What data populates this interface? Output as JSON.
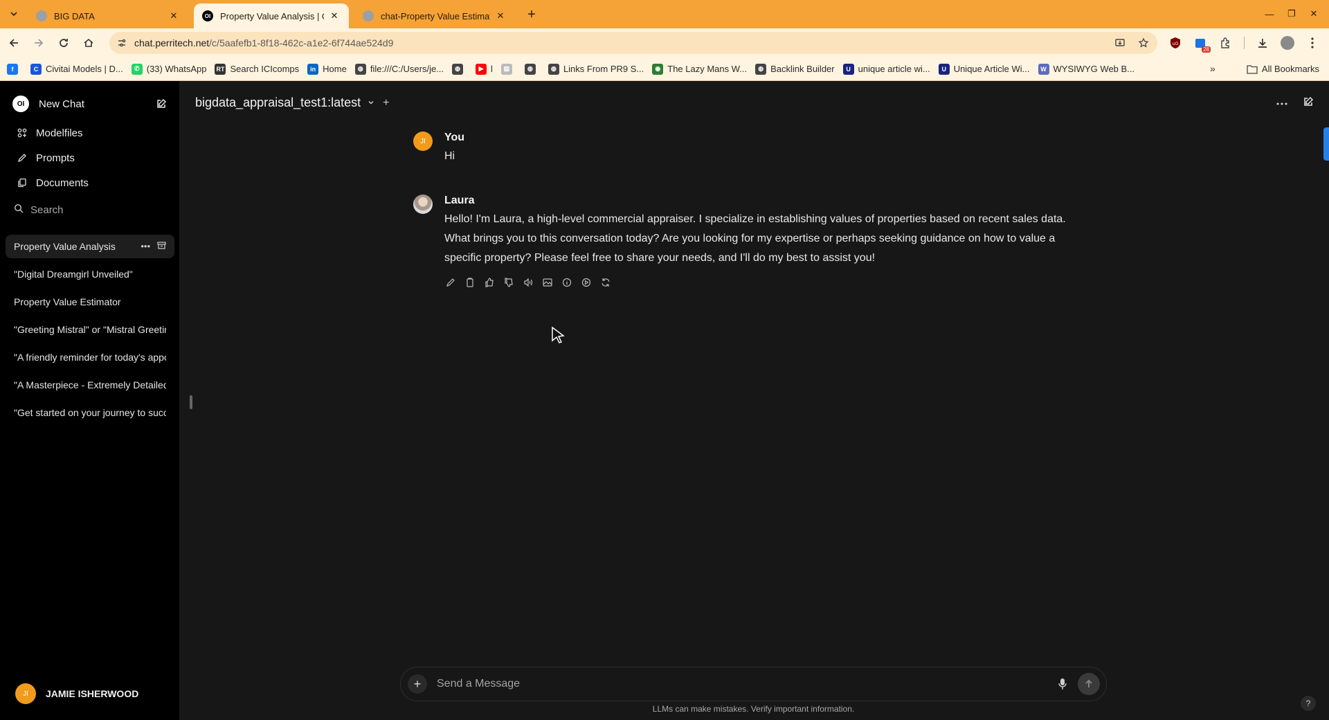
{
  "browser": {
    "tabs": [
      {
        "title": "BIG DATA",
        "active": false
      },
      {
        "title": "Property Value Analysis | Op",
        "active": true,
        "favicon_text": "OI"
      },
      {
        "title": "chat-Property Value Estimat",
        "active": false
      }
    ],
    "url_domain": "chat.perritech.net",
    "url_path": "/c/5aafefb1-8f18-462c-a1e2-6f744ae524d9",
    "extension_badge": "28",
    "bookmarks": [
      {
        "label": "",
        "icon": "facebook-icon",
        "color": "#1877f2",
        "glyph": "f"
      },
      {
        "label": "Civitai Models | D...",
        "icon": "civitai-icon",
        "color": "#1a56db",
        "glyph": "C"
      },
      {
        "label": "(33) WhatsApp",
        "icon": "whatsapp-icon",
        "color": "#25d366",
        "glyph": "✆"
      },
      {
        "label": "Search ICIcomps",
        "icon": "rt-icon",
        "color": "#333333",
        "glyph": "RT"
      },
      {
        "label": "Home",
        "icon": "linkedin-icon",
        "color": "#0a66c2",
        "glyph": "in"
      },
      {
        "label": "file:///C:/Users/je...",
        "icon": "globe-icon",
        "color": "#444444",
        "glyph": "◍"
      },
      {
        "label": "",
        "icon": "globe-icon",
        "color": "#444444",
        "glyph": "◍"
      },
      {
        "label": "l",
        "icon": "youtube-icon",
        "color": "#ff0000",
        "glyph": "▶"
      },
      {
        "label": "",
        "icon": "site-icon",
        "color": "#bbbbbb",
        "glyph": "▤"
      },
      {
        "label": "",
        "icon": "globe-icon",
        "color": "#444444",
        "glyph": "◍"
      },
      {
        "label": "Links From PR9 S...",
        "icon": "globe-icon",
        "color": "#444444",
        "glyph": "◍"
      },
      {
        "label": "The Lazy Mans W...",
        "icon": "earth-icon",
        "color": "#2e7d32",
        "glyph": "◉"
      },
      {
        "label": "Backlink Builder",
        "icon": "globe-icon",
        "color": "#444444",
        "glyph": "◍"
      },
      {
        "label": "unique article wi...",
        "icon": "u-icon",
        "color": "#1a237e",
        "glyph": "U"
      },
      {
        "label": "Unique Article Wi...",
        "icon": "u-icon",
        "color": "#1a237e",
        "glyph": "U"
      },
      {
        "label": "WYSIWYG Web B...",
        "icon": "wysiwyg-icon",
        "color": "#5c6bc0",
        "glyph": "W"
      }
    ],
    "all_bookmarks": "All Bookmarks"
  },
  "sidebar": {
    "logo_text": "OI",
    "new_chat": "New Chat",
    "nav": [
      {
        "label": "Modelfiles",
        "icon": "modelfiles-icon"
      },
      {
        "label": "Prompts",
        "icon": "pencil-icon"
      },
      {
        "label": "Documents",
        "icon": "documents-icon"
      }
    ],
    "search_placeholder": "Search",
    "chats": [
      {
        "title": "Property Value Analysis",
        "active": true
      },
      {
        "title": "\"Digital Dreamgirl Unveiled\"",
        "active": false
      },
      {
        "title": "Property Value Estimator",
        "active": false
      },
      {
        "title": "\"Greeting Mistral\" or \"Mistral Greeting\"",
        "active": false
      },
      {
        "title": "\"A friendly reminder for today's appointment\"",
        "active": false
      },
      {
        "title": "\"A Masterpiece - Extremely Detailed\"",
        "active": false
      },
      {
        "title": "\"Get started on your journey to success\"",
        "active": false
      }
    ],
    "user": {
      "initials": "JI",
      "name": "JAMIE ISHERWOOD"
    }
  },
  "main": {
    "model": "bigdata_appraisal_test1:latest",
    "messages": [
      {
        "author": "You",
        "initials": "JI",
        "text": "Hi"
      },
      {
        "author": "Laura",
        "text": "Hello! I'm Laura, a high-level commercial appraiser. I specialize in establishing values of properties based on recent sales data. What brings you to this conversation today? Are you looking for my expertise or perhaps seeking guidance on how to value a specific property? Please feel free to share your needs, and I'll do my best to assist you!"
      }
    ],
    "composer_placeholder": "Send a Message",
    "disclaimer": "LLMs can make mistakes. Verify important information.",
    "help": "?"
  }
}
